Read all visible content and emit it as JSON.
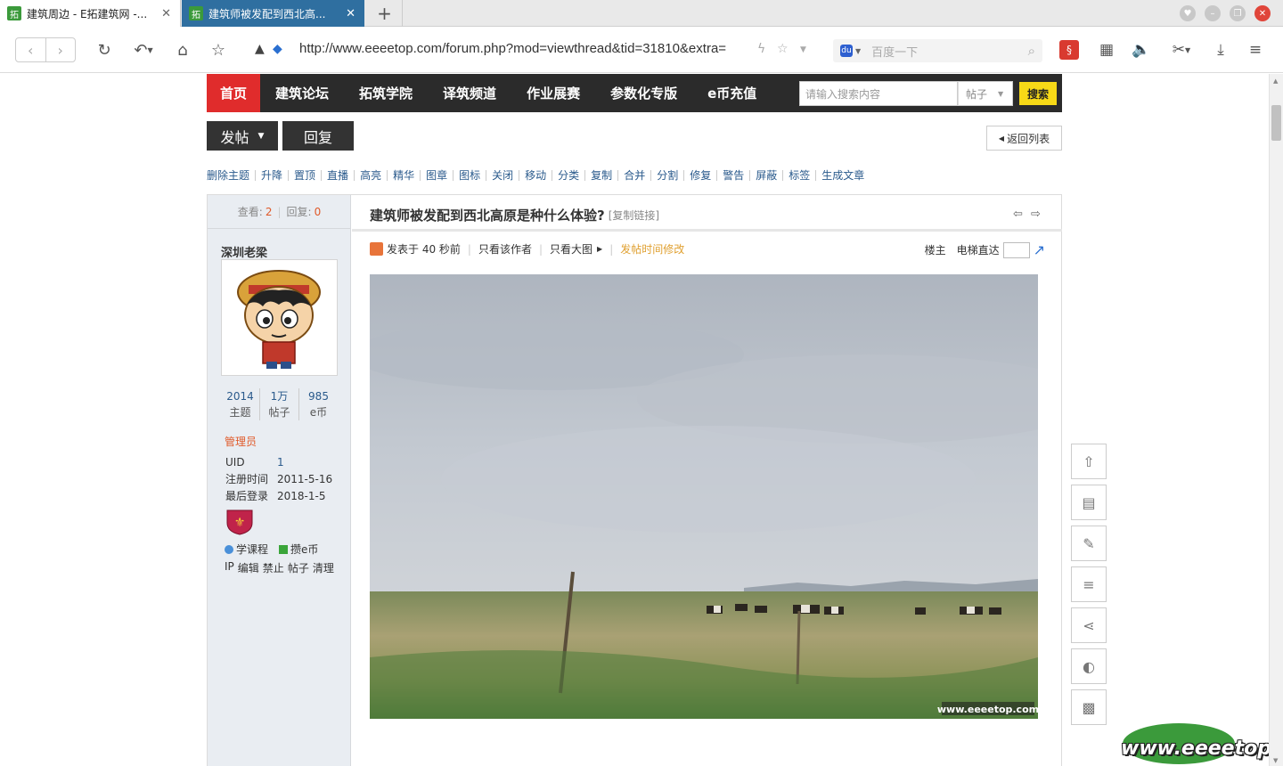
{
  "browser": {
    "tabs": [
      {
        "title": "建筑周边 - E拓建筑网 -...",
        "favicon": "拓",
        "active": false
      },
      {
        "title": "建筑师被发配到西北高...",
        "favicon": "拓",
        "active": true
      }
    ],
    "url": "http://www.eeeetop.com/forum.php?mod=viewthread&tid=31810&extra=",
    "search_placeholder": "百度一下",
    "icons": [
      "back-icon",
      "forward-icon",
      "reload-icon",
      "undo-icon",
      "home-icon",
      "star-icon",
      "secure-icon",
      "lightning-icon",
      "search-icon",
      "apps-icon",
      "speaker-icon",
      "scissors-icon",
      "download-icon",
      "menu-icon"
    ]
  },
  "site_nav": {
    "items": [
      "首页",
      "建筑论坛",
      "拓筑学院",
      "译筑频道",
      "作业展赛",
      "参数化专版",
      "e币充值"
    ],
    "search_placeholder": "请输入搜索内容",
    "search_type": "帖子",
    "search_button": "搜索"
  },
  "actions": {
    "post": "发帖",
    "reply": "回复",
    "back": "返回列表"
  },
  "mod_actions": [
    "删除主题",
    "升降",
    "置顶",
    "直播",
    "高亮",
    "精华",
    "图章",
    "图标",
    "关闭",
    "移动",
    "分类",
    "复制",
    "合并",
    "分割",
    "修复",
    "警告",
    "屏蔽",
    "标签",
    "生成文章"
  ],
  "thread": {
    "views_label": "查看:",
    "views": "2",
    "replies_label": "回复:",
    "replies": "0",
    "title": "建筑师被发配到西北高原是种什么体验?",
    "copy_link": "[复制链接]"
  },
  "author": {
    "name": "深圳老梁",
    "stats": [
      {
        "value": "2014",
        "label": "主题"
      },
      {
        "value": "1万",
        "label": "帖子"
      },
      {
        "value": "985",
        "label": "e币"
      }
    ],
    "group": "管理员",
    "info": [
      {
        "key": "UID",
        "value": "1"
      },
      {
        "key": "注册时间",
        "value": "2011-5-16"
      },
      {
        "key": "最后登录",
        "value": "2018-1-5"
      }
    ],
    "links": [
      "学课程",
      "攒e币"
    ],
    "admin_links": [
      "IP",
      "编辑",
      "禁止",
      "帖子",
      "清理"
    ]
  },
  "post_meta": {
    "posted": "发表于 40 秒前",
    "only_author": "只看该作者",
    "large_image": "只看大图",
    "edit_time": "发帖时间修改",
    "floor": "楼主",
    "elevator": "电梯直达"
  },
  "photo_watermark": "www.eeeetop.com",
  "page_watermark": "www.eeeetop.com",
  "colors": {
    "nav_bg": "#2b2b2b",
    "nav_active": "#e02c2c",
    "search_btn": "#f7d917",
    "link_blue": "#2a5a8c",
    "accent_orange": "#e05a2a",
    "tab_active": "#2f6fa0"
  }
}
